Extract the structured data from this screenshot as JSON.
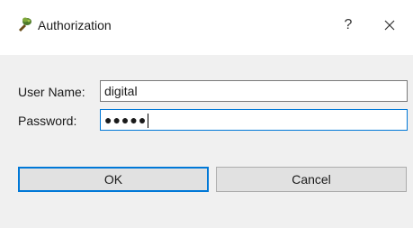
{
  "window": {
    "title": "Authorization",
    "help_glyph": "?",
    "close_icon": "close-icon",
    "app_icon": "cactus-key-icon"
  },
  "form": {
    "username_label": "User Name:",
    "username_value": "digital",
    "password_label": "Password:",
    "password_masked": "●●●●●",
    "password_length": 5
  },
  "buttons": {
    "ok_label": "OK",
    "cancel_label": "Cancel"
  },
  "colors": {
    "focus_accent": "#0078d7",
    "button_face": "#e1e1e1",
    "dialog_background": "#f0f0f0"
  }
}
